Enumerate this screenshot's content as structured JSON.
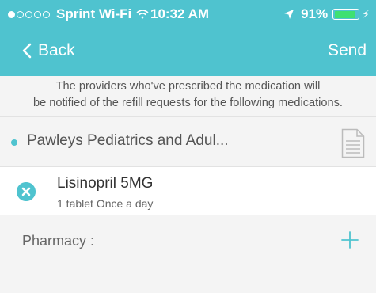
{
  "status_bar": {
    "carrier": "Sprint Wi-Fi",
    "time": "10:32 AM",
    "battery": "91%",
    "battery_level": 0.91,
    "signal_bars_filled": 1,
    "signal_bars_total": 5
  },
  "nav": {
    "back_label": "Back",
    "send_label": "Send"
  },
  "notice": {
    "line1": "The providers who've prescribed the medication will",
    "line2": "be notified of the refill requests for the following medications."
  },
  "provider": {
    "name": "Pawleys Pediatrics and Adul..."
  },
  "medication": {
    "name": "Lisinopril 5MG",
    "dose": "1 tablet Once a day"
  },
  "pharmacy": {
    "label": "Pharmacy :"
  },
  "icons": {
    "back": "chevron-left-icon",
    "document": "document-icon",
    "remove": "close-circle-icon",
    "add": "plus-icon"
  },
  "colors": {
    "accent": "#4fc3cf",
    "battery": "#3ee072",
    "background": "#f4f4f4"
  }
}
